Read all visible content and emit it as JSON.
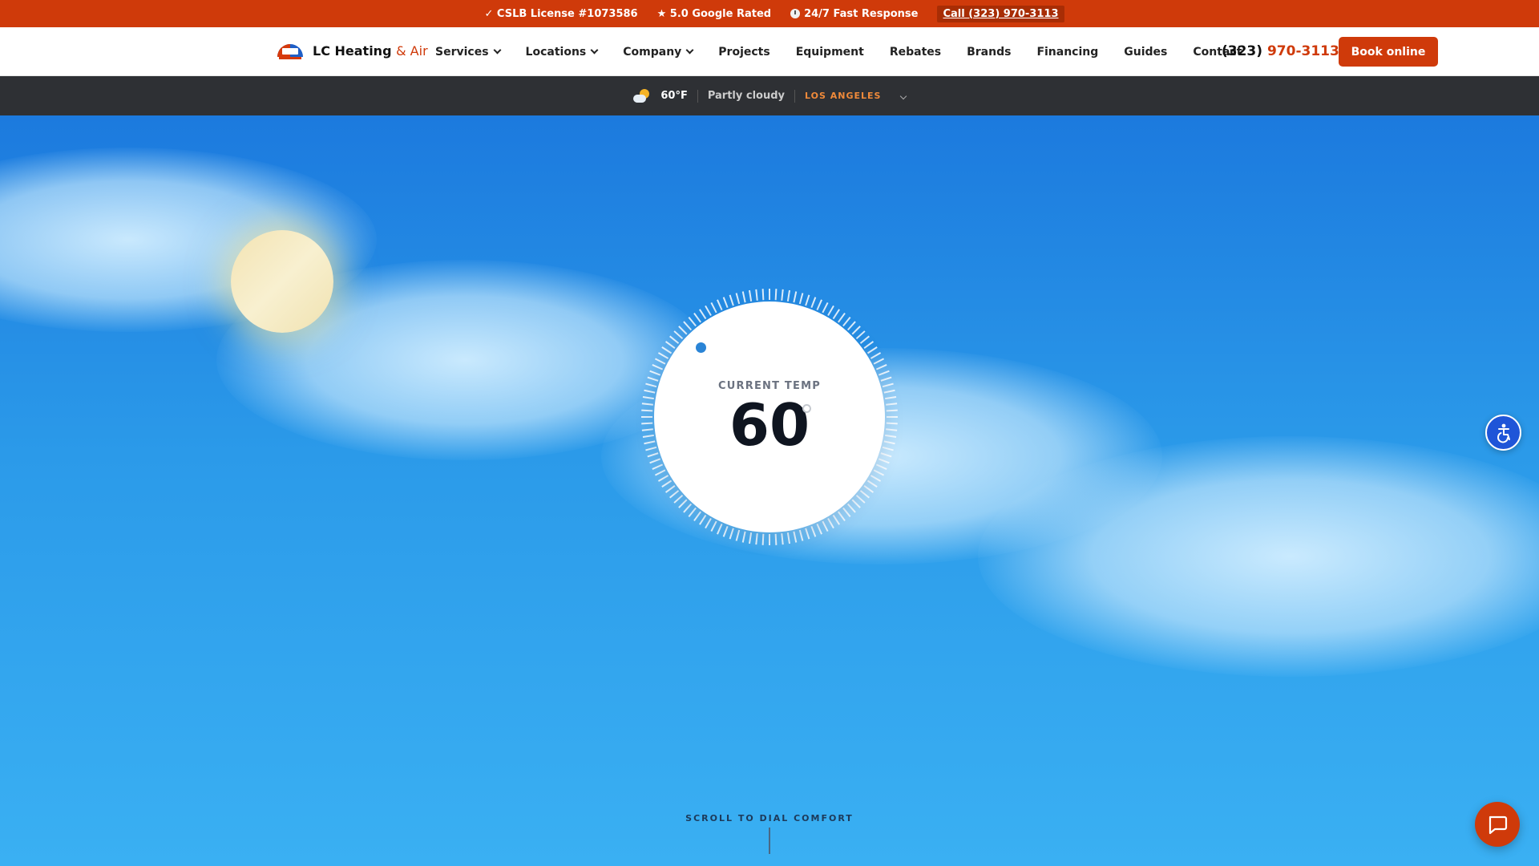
{
  "topbar": {
    "license": "✓ CSLB License #1073586",
    "rating": "★ 5.0 Google Rated",
    "response": "24/7 Fast Response",
    "call_link": "Call (323) 970-3113",
    "background_color": "#cf3a0a"
  },
  "nav": {
    "logo": {
      "name": "LC Heating",
      "accent": "& Air"
    },
    "links": [
      {
        "label": "Services",
        "has_dropdown": true
      },
      {
        "label": "Locations",
        "has_dropdown": true
      },
      {
        "label": "Company",
        "has_dropdown": true
      },
      {
        "label": "Projects",
        "has_dropdown": false
      },
      {
        "label": "Equipment",
        "has_dropdown": false
      },
      {
        "label": "Rebates",
        "has_dropdown": false
      },
      {
        "label": "Brands",
        "has_dropdown": false
      },
      {
        "label": "Financing",
        "has_dropdown": false
      },
      {
        "label": "Guides",
        "has_dropdown": false
      },
      {
        "label": "Contact",
        "has_dropdown": false
      }
    ],
    "phone_area": "(323)",
    "phone_number": "970-3113",
    "cta_label": "Book online"
  },
  "weather": {
    "icon": "partly-cloudy-icon",
    "temperature": "60°F",
    "condition": "Partly cloudy",
    "city": "LOS ANGELES"
  },
  "hero": {
    "dial_label": "CURRENT TEMP",
    "dial_value": "60",
    "scroll_cue": "SCROLL TO DIAL COMFORT"
  },
  "floating": {
    "accessibility_icon": "accessibility-icon",
    "chat_icon": "chat-icon"
  },
  "colors": {
    "brand_orange": "#cf3a0a",
    "accessibility_blue": "#1f55d8",
    "weather_strip": "#2e3034"
  }
}
